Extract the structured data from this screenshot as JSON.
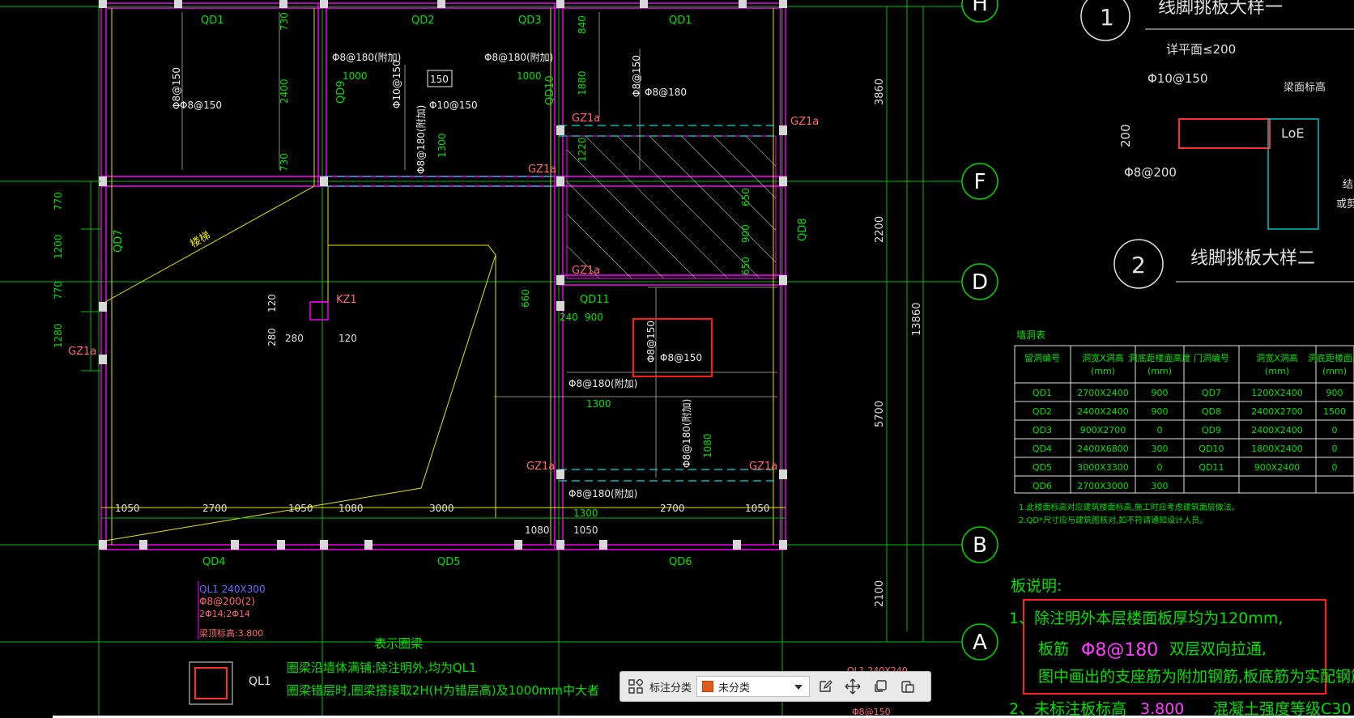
{
  "drawing": {
    "axes": {
      "h": "H",
      "f": "F",
      "d": "D",
      "b": "B",
      "a": "A"
    },
    "room_labels": {
      "qd1a": "QD1",
      "qd2": "QD2",
      "qd3": "QD3",
      "qd1b": "QD1",
      "qd4": "QD4",
      "qd5": "QD5",
      "qd6": "QD6",
      "qd7": "QD7",
      "qd8": "QD8",
      "qd9": "QD9",
      "qd10": "QD10",
      "qd11": "QD11"
    },
    "rebar": {
      "r1": "Φ8@180(附加)",
      "r2": "Φ8@180(附加)",
      "r3": "Φ8@150",
      "r4": "Φ8@150",
      "r5": "Φ10@150",
      "r6": "Φ10@150",
      "r7": "Φ8@180(附加)",
      "r8": "Φ8@150",
      "r9": "Φ8@180",
      "r10": "Φ8@180(附加)",
      "r11": "Φ8@180(附加)",
      "r12": "Φ8@180(附加)",
      "r13": "Φ8@150",
      "r14": "Φ8@150"
    },
    "dims": {
      "d730a": "730",
      "d2400": "2400",
      "d730b": "730",
      "d1000a": "1000",
      "d1000b": "1000",
      "d1300a": "1300",
      "d840": "840",
      "d1880": "1880",
      "d1220": "1220",
      "d650a": "650",
      "d900": "900",
      "d650b": "650",
      "d660": "660",
      "d240": "240",
      "d900b": "900",
      "d1300b": "1300",
      "d1080a": "1080",
      "d1300c": "1300",
      "d120a": "120",
      "d280a": "280",
      "d280b": "280",
      "d120b": "120",
      "l770a": "770",
      "l1200": "1200",
      "l770b": "770",
      "l1280": "1280",
      "r3860": "3860",
      "r2200": "2200",
      "r5700": "5700",
      "r2100": "2100",
      "r13860": "13860",
      "b1050a": "1050",
      "b2700a": "2700",
      "b1050b": "1050",
      "b1080": "1080",
      "b3000": "3000",
      "b1080c": "1080",
      "b1050c": "1050",
      "b2700b": "2700",
      "b1050d": "1050",
      "b1300": "1300",
      "box150": "150"
    },
    "gz": {
      "g1": "GZ1a",
      "g2": "GZ1a",
      "g3": "GZ1a",
      "g4": "GZ1a",
      "g5": "GZ1a",
      "g6": "GZ1a",
      "g7": "GZ1a",
      "kz1": "KZ1"
    },
    "stair": "楼梯",
    "legend": {
      "ql_head": "QL1 240X300",
      "ql_r1": "Φ8@200(2)",
      "ql_r2": "2Φ14;2Φ14",
      "ql_elev": "梁顶标高:3.800",
      "title": "表示圈梁",
      "ql1": "QL1",
      "line1": "圈梁沿墙体满铺;除注明外,均为QL1",
      "line2": "圈梁错层时,圈梁搭接取2H(H为错层高)及1000mm中大者"
    },
    "detail": {
      "n1": "1",
      "t1": "线脚挑板大样一",
      "n2": "2",
      "t2": "线脚挑板大样二",
      "le": "详平面≤200",
      "r1": "Φ10@150",
      "r2": "Φ8@200",
      "h200": "200",
      "loe": "LoE",
      "beam": "梁面标高",
      "edge1": "结",
      "edge2": "或剪"
    },
    "table": {
      "caption": "墙洞表",
      "headers": [
        "留洞编号",
        "洞宽X洞高\n(mm)",
        "洞底距楼面高度\n(mm)",
        "门洞编号",
        "洞宽X洞高\n(mm)",
        "洞底距楼面高\n(mm)"
      ],
      "rows": [
        [
          "QD1",
          "2700X2400",
          "900",
          "QD7",
          "1200X2400",
          "900"
        ],
        [
          "QD2",
          "2400X2400",
          "900",
          "QD8",
          "2400X2700",
          "1500"
        ],
        [
          "QD3",
          "900X2700",
          "0",
          "QD9",
          "2400X2400",
          "0"
        ],
        [
          "QD4",
          "2400X6800",
          "300",
          "QD10",
          "1800X2400",
          "0"
        ],
        [
          "QD5",
          "3000X3300",
          "0",
          "QD11",
          "900X2400",
          "0"
        ],
        [
          "QD6",
          "2700X3000",
          "300",
          "",
          "",
          ""
        ]
      ],
      "note1": "1.此楼面标高对应建筑楼面标高,施工时应考虑建筑面层做法。",
      "note2": "2.QD*尺寸应与建筑图核对,如不符请通知设计人员。"
    },
    "notes": {
      "title": "板说明:",
      "l1": "1、除注明外本层楼面板厚均为120mm,",
      "l2a": "板筋",
      "l2b": "Φ8@180",
      "l2c": "双层双向拉通,",
      "l3": "图中画出的支座筋为附加钢筋,板底筋为实配钢筋。",
      "l4a": "2、未标注板标高",
      "l4b": "3.800",
      "l4c": "混凝土强度等级C30"
    },
    "partial": {
      "p1": "QL1 240X240",
      "p2": "Φ8@150"
    }
  },
  "toolbar": {
    "label": "标注分类",
    "selected": "未分类",
    "selected_color": "#e25b1b"
  }
}
